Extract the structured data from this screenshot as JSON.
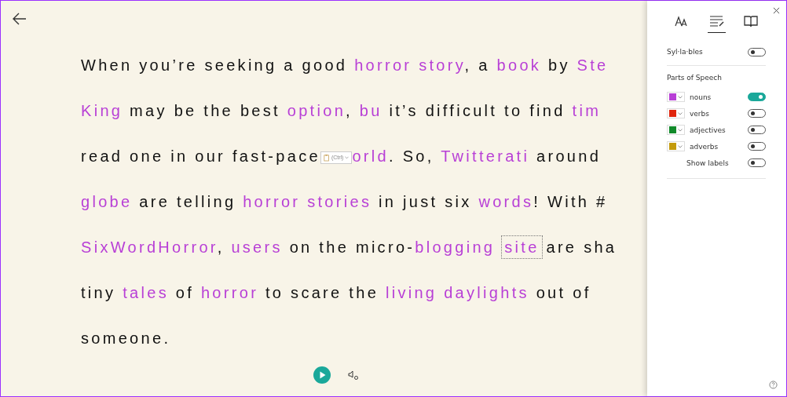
{
  "reader": {
    "lines": [
      [
        {
          "text": "When you’re seeking a good ",
          "noun": false
        },
        {
          "text": "horror story",
          "noun": true
        },
        {
          "text": ", a ",
          "noun": false
        },
        {
          "text": "book",
          "noun": true
        },
        {
          "text": " by ",
          "noun": false
        },
        {
          "text": "Ste",
          "noun": true
        }
      ],
      [
        {
          "text": "King",
          "noun": true
        },
        {
          "text": " may be the best ",
          "noun": false
        },
        {
          "text": "option",
          "noun": true
        },
        {
          "text": ", ",
          "noun": false
        },
        {
          "text": "bu",
          "noun": true
        },
        {
          "text": " it’s difficult to find ",
          "noun": false
        },
        {
          "text": "tim",
          "noun": true
        }
      ],
      [
        {
          "text": "read one in our fast-pace",
          "noun": false
        },
        {
          "kind": "paste",
          "text": "(Ctrl)"
        },
        {
          "text": "orld",
          "noun": true
        },
        {
          "text": ". So, ",
          "noun": false
        },
        {
          "text": "Twitterati",
          "noun": true
        },
        {
          "text": " around",
          "noun": false
        }
      ],
      [
        {
          "text": "globe",
          "noun": true
        },
        {
          "text": " are telling ",
          "noun": false
        },
        {
          "text": "horror stories",
          "noun": true
        },
        {
          "text": " in just six ",
          "noun": false
        },
        {
          "text": "words",
          "noun": true
        },
        {
          "text": "! With #",
          "noun": false
        }
      ],
      [
        {
          "text": "SixWordHorror",
          "noun": true
        },
        {
          "text": ", ",
          "noun": false
        },
        {
          "text": "users",
          "noun": true
        },
        {
          "text": " on the micro-",
          "noun": false
        },
        {
          "text": "blogging",
          "noun": true
        },
        {
          "text": "site",
          "noun": true,
          "focused": true
        },
        {
          "text": " are sha",
          "noun": false
        }
      ],
      [
        {
          "text": "tiny ",
          "noun": false
        },
        {
          "text": "tales",
          "noun": true
        },
        {
          "text": " of ",
          "noun": false
        },
        {
          "text": "horror",
          "noun": true
        },
        {
          "text": " to scare the ",
          "noun": false
        },
        {
          "text": "living daylights",
          "noun": true
        },
        {
          "text": " out of",
          "noun": false
        }
      ],
      [
        {
          "text": "someone.",
          "noun": false
        }
      ]
    ]
  },
  "panel": {
    "tabs": [
      {
        "kind": "text",
        "selected": false
      },
      {
        "kind": "grammar",
        "selected": true
      },
      {
        "kind": "book",
        "selected": false
      }
    ],
    "syllables": {
      "label": "Syl·la·bles",
      "on": false
    },
    "parts_heading": "Parts of Speech",
    "parts": [
      {
        "label": "nouns",
        "color": "#b83fd6",
        "on": true
      },
      {
        "label": "verbs",
        "color": "#e0250e",
        "on": false
      },
      {
        "label": "adjectives",
        "color": "#118a2a",
        "on": false
      },
      {
        "label": "adverbs",
        "color": "#c49b0c",
        "on": false
      },
      {
        "label": "Show labels",
        "on": false
      }
    ]
  }
}
